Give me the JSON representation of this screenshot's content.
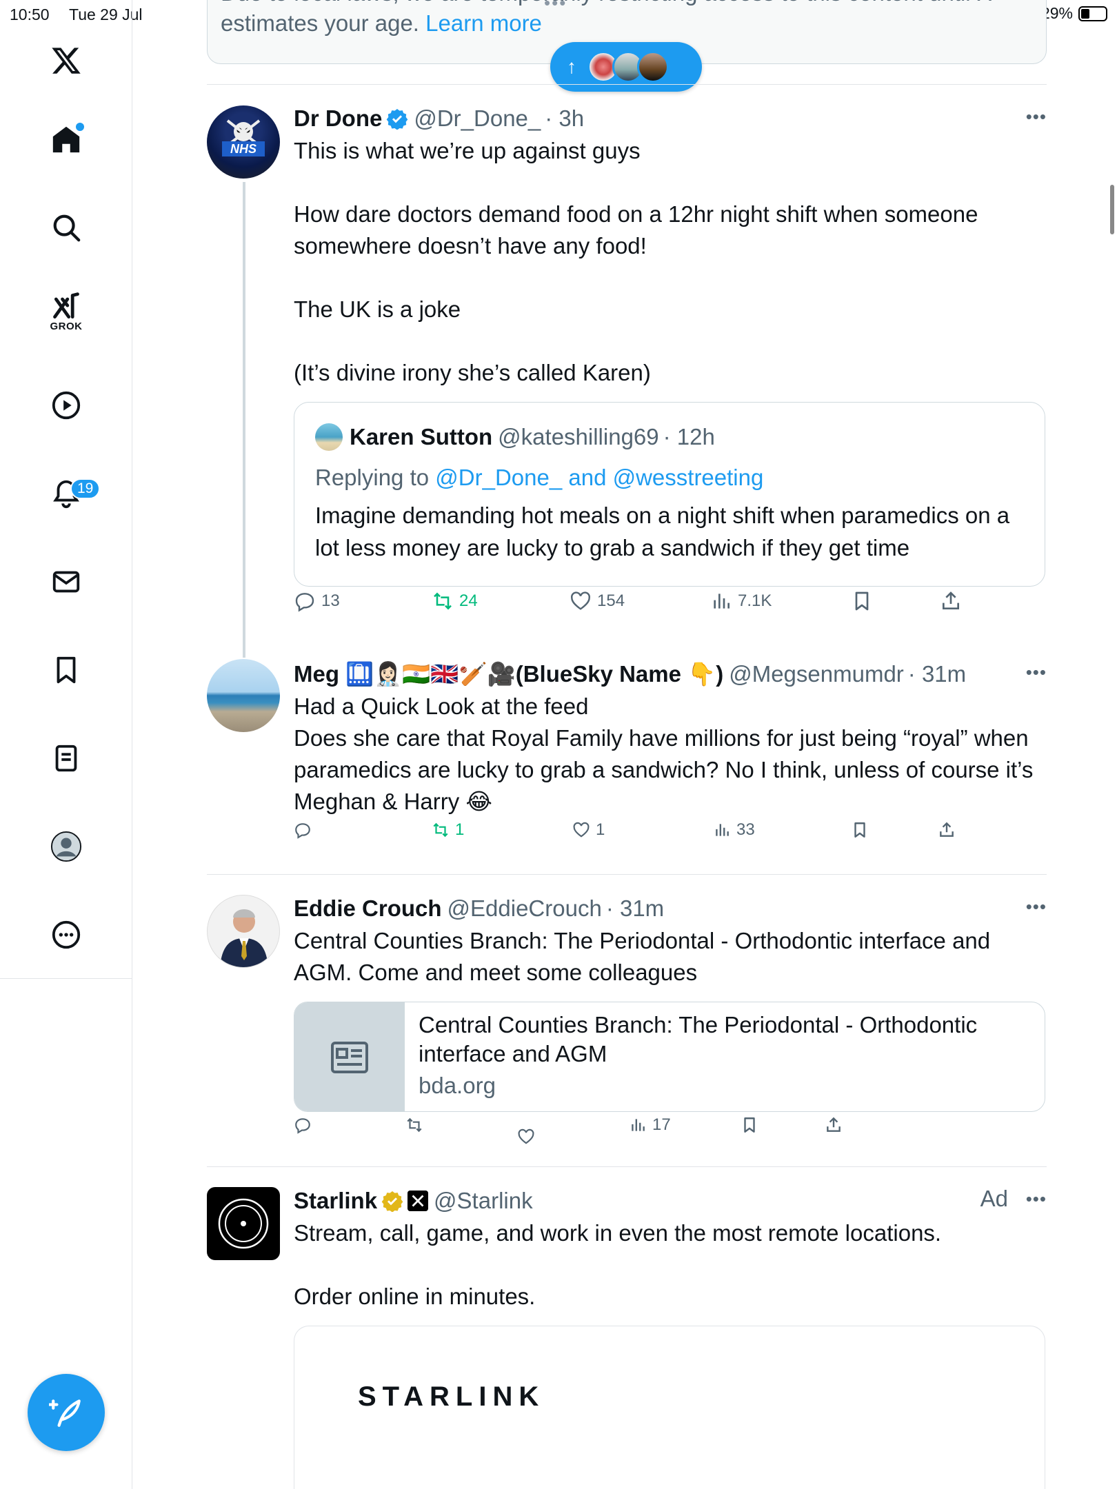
{
  "status_bar": {
    "time": "10:50",
    "date": "Tue 29 Jul",
    "battery": "29%"
  },
  "sidebar": {
    "items": [
      {
        "name": "x-logo-icon"
      },
      {
        "name": "home-icon"
      },
      {
        "name": "search-icon"
      },
      {
        "name": "grok-icon",
        "label": "GROK"
      },
      {
        "name": "video-icon"
      },
      {
        "name": "notifications-icon",
        "badge": "19"
      },
      {
        "name": "messages-icon"
      },
      {
        "name": "bookmarks-icon"
      },
      {
        "name": "lists-icon"
      },
      {
        "name": "profile-icon"
      },
      {
        "name": "more-icon"
      }
    ]
  },
  "notice": {
    "text_line1": "Due to local laws, we are temporarily restricting access to this content until X",
    "text_line2": "estimates your age.",
    "link": "Learn more"
  },
  "tweets": [
    {
      "name": "Dr Done",
      "handle": "@Dr_Done_",
      "time": "· 3h",
      "text": "This is what we’re up against guys\n\nHow dare doctors demand food on a 12hr night shift when someone somewhere doesn’t have any food!\n\nThe UK is a joke\n\n(It’s divine irony she’s called Karen)",
      "quote": {
        "name": "Karen Sutton",
        "handle": "@kateshilling69",
        "time": "· 12h",
        "reply_prefix": "Replying to",
        "reply_to": "@Dr_Done_ and @wesstreeting",
        "text": "Imagine demanding hot meals on a night shift when paramedics on a lot less money are lucky to grab a sandwich if they get time"
      },
      "replies": "13",
      "reposts": "24",
      "likes": "154",
      "views": "7.1K"
    },
    {
      "name": "Meg 🛄👩🏻‍⚕️🇮🇳🇬🇧🏏🎥(BlueSky Name 👇)",
      "handle": "@Megsenmumdr",
      "time": "· 31m",
      "text": "Had a Quick Look at the feed\nDoes she care that Royal Family have millions for just being “royal” when paramedics are lucky to grab a sandwich? No I think, unless of course it’s Meghan & Harry 😂",
      "replies": "",
      "reposts": "1",
      "likes": "1",
      "views": "33"
    },
    {
      "name": "Eddie Crouch",
      "handle": "@EddieCrouch",
      "time": "· 31m",
      "text": "Central Counties Branch: The Periodontal - Orthodontic interface and AGM.  Come and meet some colleagues",
      "card": {
        "title": "Central Counties Branch: The Periodontal - Orthodontic interface and AGM",
        "domain": "bda.org"
      },
      "replies": "",
      "reposts": "",
      "likes": "",
      "views": "17"
    },
    {
      "name": "Starlink",
      "handle": "@Starlink",
      "ad_label": "Ad",
      "text": "Stream, call, game, and work in even the most remote locations.\n\nOrder online in minutes.",
      "media_wordmark": "STARLINK"
    }
  ],
  "colors": {
    "accent": "#1d9bf0",
    "repost_green": "#00ba7c",
    "muted": "#536471",
    "gold_verified": "#e2b719"
  }
}
